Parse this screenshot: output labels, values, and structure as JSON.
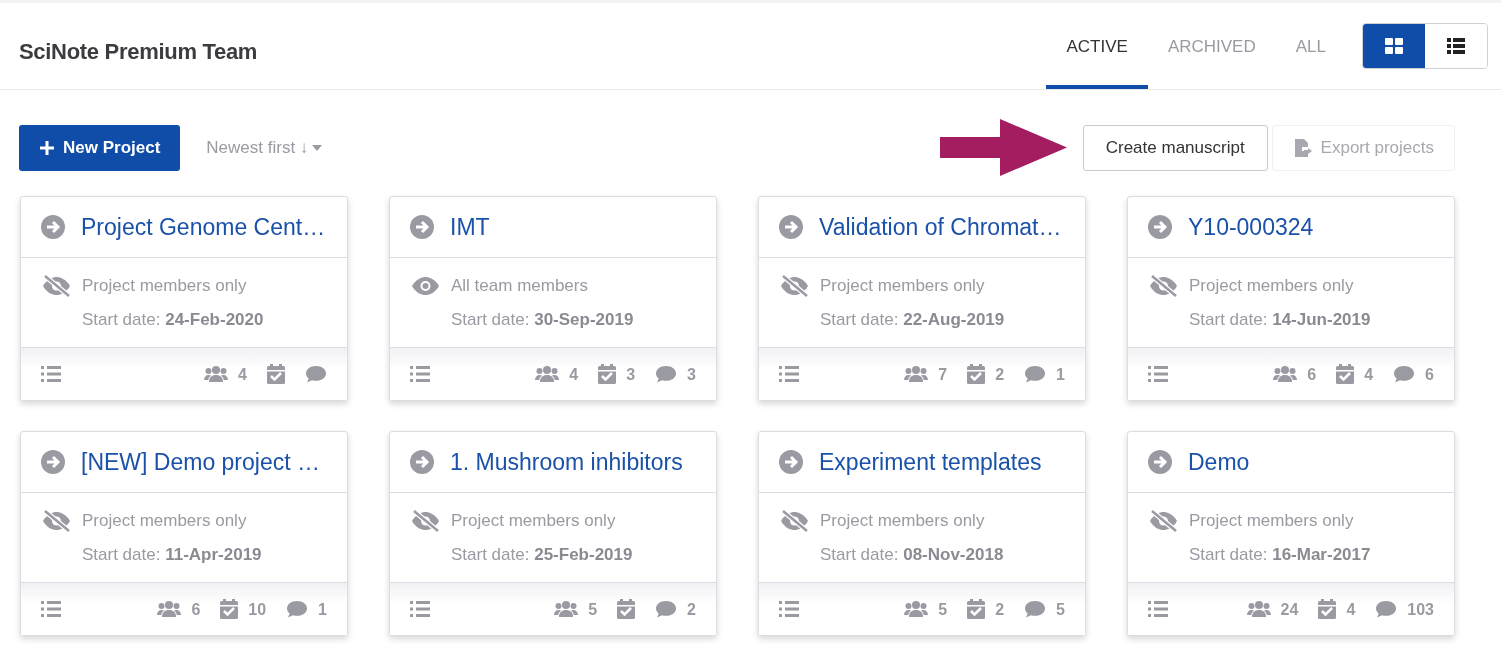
{
  "header": {
    "title": "SciNote Premium Team"
  },
  "tabs": [
    {
      "label": "ACTIVE",
      "selected": true
    },
    {
      "label": "ARCHIVED",
      "selected": false
    },
    {
      "label": "ALL",
      "selected": false
    }
  ],
  "view_toggle": [
    {
      "kind": "cards",
      "selected": true
    },
    {
      "kind": "table",
      "selected": false
    }
  ],
  "toolbar": {
    "new_button": "New Project",
    "sort": "Newest first ↓",
    "create_button": "Create manuscript",
    "export_button": {
      "label": "Export projects",
      "disabled": true
    }
  },
  "projects": [
    {
      "name": "Project Genome Cent…",
      "kind": "members",
      "visibility_label": "Project members only",
      "start": "Start date: **24-Feb-2020**",
      "members": "4"
    },
    {
      "name": "IMT",
      "kind": "team",
      "visibility_label": "All team members",
      "start": "Start date: **30-Sep-2019**",
      "members": "4",
      "tasks": "3",
      "comments": "3"
    },
    {
      "name": "Validation of Chromat…",
      "kind": "members",
      "visibility_label": "Project members only",
      "start": "Start date: **22-Aug-2019**",
      "members": "7",
      "tasks": "2",
      "comments": "1"
    },
    {
      "name": "Y10-000324",
      "kind": "members",
      "visibility_label": "Project members only",
      "start": "Start date: **14-Jun-2019**",
      "members": "6",
      "tasks": "4",
      "comments": "6"
    },
    {
      "name": "[NEW] Demo project …",
      "kind": "members",
      "visibility_label": "Project members only",
      "start": "Start date: **11-Apr-2019**",
      "members": "6",
      "tasks": "10",
      "comments": "1"
    },
    {
      "name": "1. Mushroom inhibitors",
      "kind": "members",
      "visibility_label": "Project members only",
      "start": "Start date: **25-Feb-2019**",
      "members": "5",
      "comments": "2"
    },
    {
      "name": "Experiment templates",
      "kind": "members",
      "visibility_label": "Project members only",
      "start": "Start date: **08-Nov-2018**",
      "members": "5",
      "tasks": "2",
      "comments": "5"
    },
    {
      "name": "Demo",
      "kind": "members",
      "visibility_label": "Project members only",
      "start": "Start date: **16-Mar-2017**",
      "members": "24",
      "tasks": "4",
      "comments": "103"
    }
  ]
}
